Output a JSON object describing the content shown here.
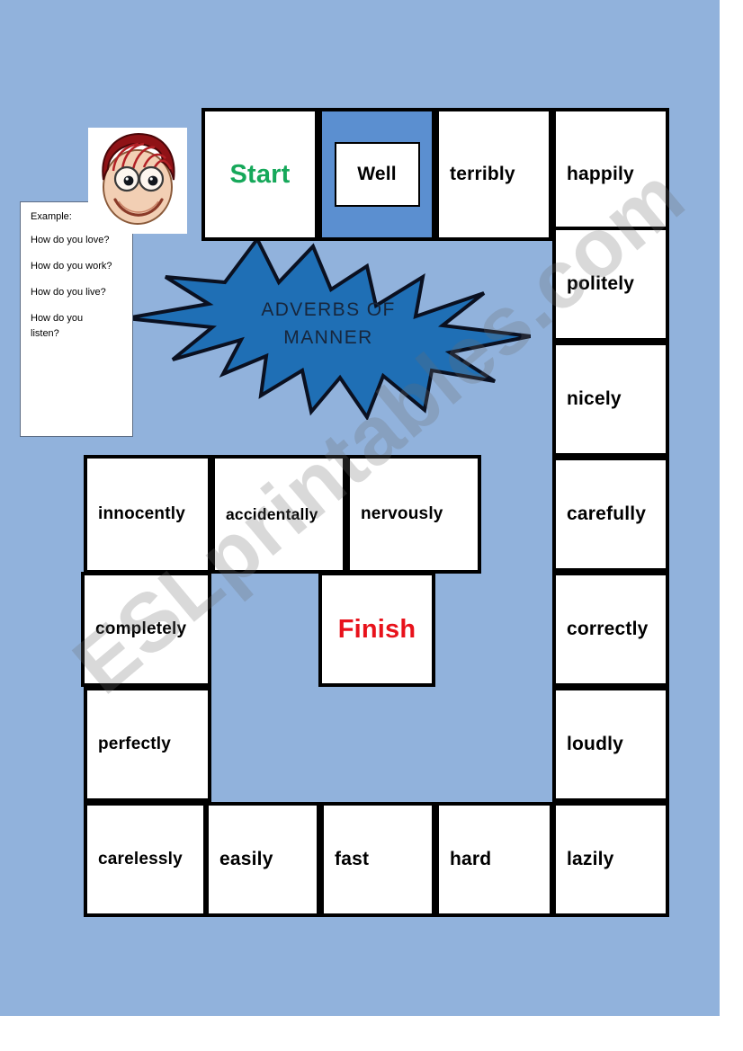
{
  "worksheet": {
    "title": "ADVERBS OF MANNER",
    "title_line1": "ADVERBS OF",
    "title_line2": "MANNER",
    "watermark": "ESLprintables.com",
    "colors": {
      "background": "#91b2dc",
      "burst_fill": "#1f6fb5",
      "well_cell": "#5b8fd0",
      "start_text": "#16a85a",
      "finish_text": "#e8121b",
      "cell_border": "#000000"
    }
  },
  "example_box": {
    "heading": "Example:",
    "questions": [
      "How do you love?",
      "How do you work?",
      "How do you live?",
      "How do you listen?"
    ]
  },
  "illustration": {
    "name": "boy-with-glasses-face"
  },
  "board": {
    "top_row": [
      {
        "label": "Start",
        "type": "start"
      },
      {
        "label": "Well",
        "type": "highlight"
      },
      {
        "label": "terribly",
        "type": "word"
      },
      {
        "label": "happily",
        "type": "word"
      }
    ],
    "right_column": [
      {
        "label": "politely",
        "type": "word"
      },
      {
        "label": "nicely",
        "type": "word"
      },
      {
        "label": "carefully",
        "type": "word"
      },
      {
        "label": "correctly",
        "type": "word"
      },
      {
        "label": "loudly",
        "type": "word"
      },
      {
        "label": "lazily",
        "type": "word"
      }
    ],
    "inner_row": [
      {
        "label": "innocently",
        "type": "word"
      },
      {
        "label": "accidentally",
        "type": "word"
      },
      {
        "label": "nervously",
        "type": "word"
      }
    ],
    "left_column": [
      {
        "label": "completely",
        "type": "word"
      },
      {
        "label": "perfectly",
        "type": "word"
      },
      {
        "label": "carelessly",
        "type": "word"
      }
    ],
    "bottom_row": [
      {
        "label": "easily",
        "type": "word"
      },
      {
        "label": "fast",
        "type": "word"
      },
      {
        "label": "hard",
        "type": "word"
      }
    ],
    "finish": {
      "label": "Finish",
      "type": "finish"
    }
  }
}
